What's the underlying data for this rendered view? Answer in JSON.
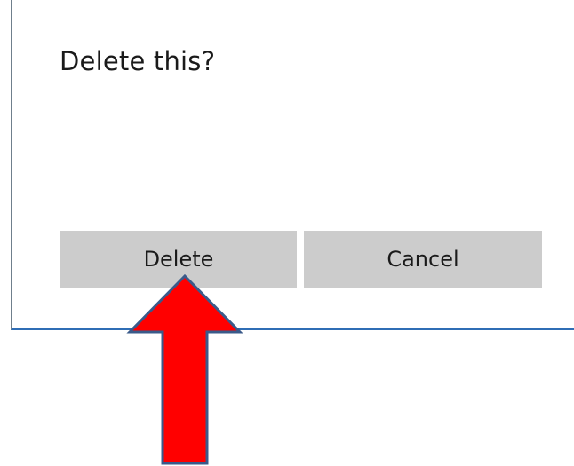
{
  "dialog": {
    "title": "Delete this?",
    "delete_label": "Delete",
    "cancel_label": "Cancel"
  },
  "annotation": {
    "icon": "up-arrow-icon",
    "color": "#ff0000",
    "outline": "#3a5a8a"
  }
}
